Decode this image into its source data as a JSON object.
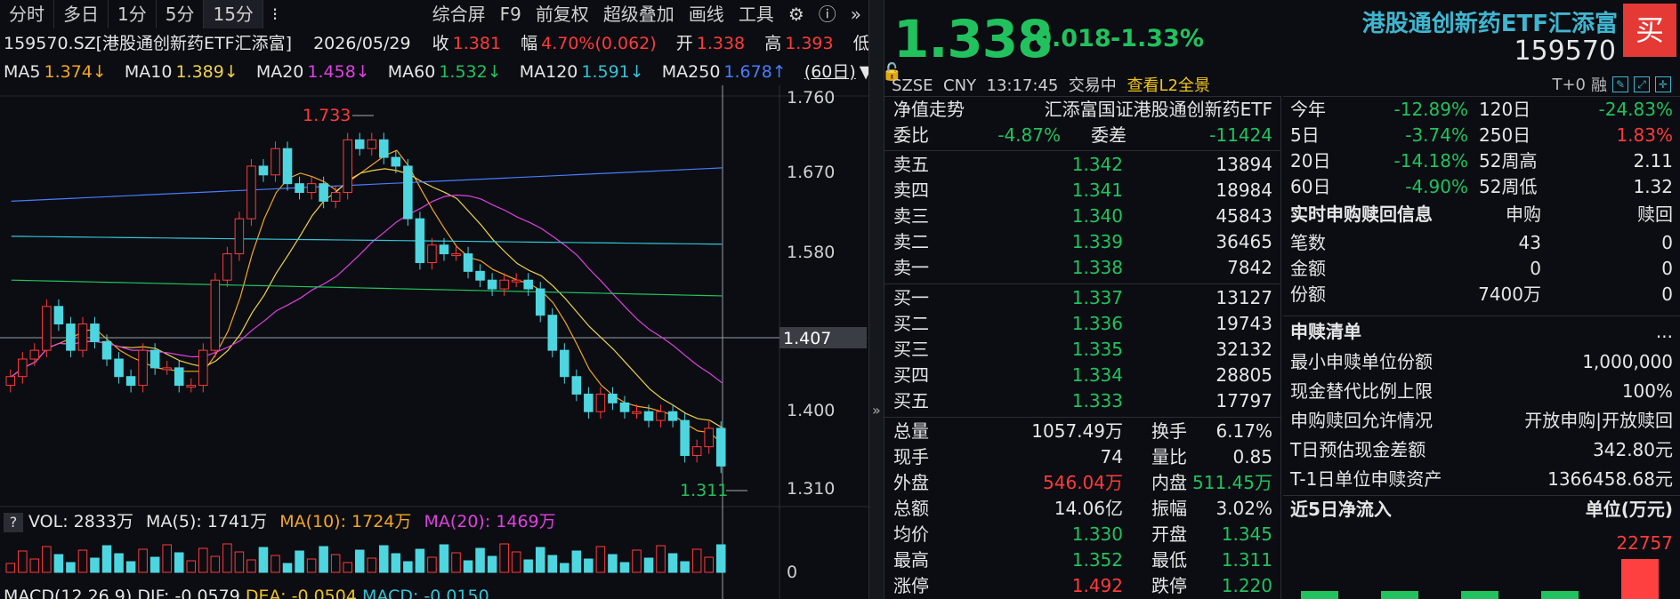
{
  "toolbar": {
    "tabs": [
      "分时",
      "多日",
      "1分",
      "5分",
      "15分"
    ],
    "menu_icon": "menu-icon",
    "right_items": [
      "综合屏",
      "F9",
      "前复权",
      "超级叠加",
      "画线",
      "工具"
    ],
    "gear_icon": "gear-icon",
    "help_icon": "help-icon",
    "more_icon": "double-chevron-icon"
  },
  "info": {
    "code_name": "159570.SZ[港股通创新药ETF汇添富]",
    "date": "2026/05/29",
    "close_label": "收",
    "close": "1.381",
    "range_label": "幅",
    "range": "4.70%(0.062)",
    "open_label": "开",
    "open": "1.338",
    "high_label": "高",
    "high": "1.393",
    "low_label": "低"
  },
  "ma": {
    "ma5_label": "MA5",
    "ma5": "1.374↓",
    "ma10_label": "MA10",
    "ma10": "1.389↓",
    "ma20_label": "MA20",
    "ma20": "1.458↓",
    "ma60_label": "MA60",
    "ma60": "1.532↓",
    "ma120_label": "MA120",
    "ma120": "1.591↓",
    "ma250_label": "MA250",
    "ma250": "1.678↑",
    "period": "(60日)"
  },
  "axis": {
    "y_ticks": [
      "1.760",
      "1.670",
      "1.580",
      "1.407",
      "1.400",
      "1.310"
    ],
    "vol_zero": "0",
    "high_mark": "1.733",
    "low_mark": "1.311"
  },
  "vol": {
    "help": "?",
    "vol_label": "VOL: 2833万",
    "ma5": "MA(5): 1741万",
    "ma10": "MA(10): 1724万",
    "ma20": "MA(20): 1469万"
  },
  "macd": {
    "label": "MACD(12,26,9)",
    "dif": "DIF: -0.0579",
    "dea": "DEA: -0.0504",
    "macd": "MACD: -0.0150"
  },
  "header": {
    "price": "1.338",
    "change": "-0.018",
    "change_pct": "-1.33%",
    "fund_name": "港股通创新药ETF汇添富",
    "fund_code": "159570",
    "buy_label": "买",
    "market": "SZSE",
    "currency": "CNY",
    "time": "13:17:45",
    "status": "交易中",
    "l2_link": "查看L2全景",
    "t0": "T+0",
    "margin": "融"
  },
  "order_book": {
    "nav_label": "净值走势",
    "nav_name": "汇添富国证港股通创新药ETF",
    "weibi_label": "委比",
    "weibi": "-4.87%",
    "weicha_label": "委差",
    "weicha": "-11424",
    "asks": [
      {
        "label": "卖五",
        "price": "1.342",
        "vol": "13894"
      },
      {
        "label": "卖四",
        "price": "1.341",
        "vol": "18984"
      },
      {
        "label": "卖三",
        "price": "1.340",
        "vol": "45843"
      },
      {
        "label": "卖二",
        "price": "1.339",
        "vol": "36465"
      },
      {
        "label": "卖一",
        "price": "1.338",
        "vol": "7842"
      }
    ],
    "bids": [
      {
        "label": "买一",
        "price": "1.337",
        "vol": "13127"
      },
      {
        "label": "买二",
        "price": "1.336",
        "vol": "19743"
      },
      {
        "label": "买三",
        "price": "1.335",
        "vol": "32132"
      },
      {
        "label": "买四",
        "price": "1.334",
        "vol": "28805"
      },
      {
        "label": "买五",
        "price": "1.333",
        "vol": "17797"
      }
    ]
  },
  "stats": [
    {
      "l1": "总量",
      "v1": "1057.49万",
      "l2": "换手",
      "v2": "6.17%"
    },
    {
      "l1": "现手",
      "v1": "74",
      "l2": "量比",
      "v2": "0.85"
    },
    {
      "l1": "外盘",
      "v1": "546.04万",
      "l2": "内盘",
      "v2": "511.45万"
    },
    {
      "l1": "总额",
      "v1": "14.06亿",
      "l2": "振幅",
      "v2": "3.02%"
    },
    {
      "l1": "均价",
      "v1": "1.330",
      "l2": "开盘",
      "v2": "1.345"
    },
    {
      "l1": "最高",
      "v1": "1.352",
      "l2": "最低",
      "v2": "1.311"
    },
    {
      "l1": "涨停",
      "v1": "1.492",
      "l2": "跌停",
      "v2": "1.220"
    }
  ],
  "perf": [
    {
      "l1": "今年",
      "v1": "-12.89%",
      "l2": "120日",
      "v2": "-24.83%"
    },
    {
      "l1": "5日",
      "v1": "-3.74%",
      "l2": "250日",
      "v2": "1.83%"
    },
    {
      "l1": "20日",
      "v1": "-14.18%",
      "l2": "52周高",
      "v2": "2.11"
    },
    {
      "l1": "60日",
      "v1": "-4.90%",
      "l2": "52周低",
      "v2": "1.32"
    }
  ],
  "realtime": {
    "title": "实时申购赎回信息",
    "col_sub": "申购",
    "col_red": "赎回",
    "rows": [
      {
        "label": "笔数",
        "sub": "43",
        "red": "0"
      },
      {
        "label": "金额",
        "sub": "0",
        "red": "0"
      },
      {
        "label": "份额",
        "sub": "7400万",
        "red": "0"
      }
    ]
  },
  "list": {
    "title": "申赎清单",
    "more": "...",
    "rows": [
      {
        "label": "最小申赎单位份额",
        "value": "1,000,000"
      },
      {
        "label": "现金替代比例上限",
        "value": "100%"
      },
      {
        "label": "申购赎回允许情况",
        "value": "开放申购|开放赎回"
      },
      {
        "label": "T日预估现金差额",
        "value": "342.80元"
      },
      {
        "label": "T-1日单位申赎资产",
        "value": "1366458.68元"
      }
    ]
  },
  "inflow": {
    "title": "近5日净流入",
    "unit": "单位(万元)",
    "top_value": "22757"
  },
  "colors": {
    "up": "#ff3b3b",
    "down": "#21c25e",
    "candle_down": "#4dd6e0",
    "accent": "#3fb6d0"
  }
}
